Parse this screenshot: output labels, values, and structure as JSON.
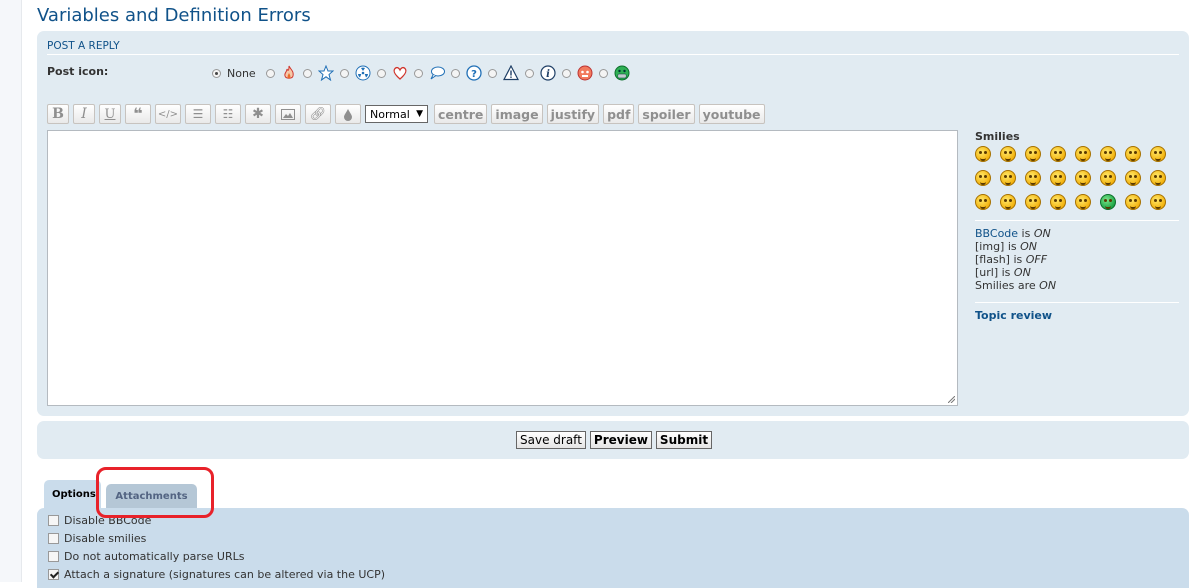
{
  "page_title": "Variables and Definition Errors",
  "panel": {
    "title": "POST A REPLY",
    "post_icon_label": "Post icon:",
    "none_label": "None",
    "icons": [
      "fire-icon",
      "star-icon",
      "radioactive-icon",
      "heart-icon",
      "speech-bubble-icon",
      "question-icon",
      "warning-icon",
      "info-icon",
      "mad-face-icon",
      "grin-face-icon"
    ]
  },
  "toolbar": {
    "buttons": [
      "bold",
      "italic",
      "underline",
      "quote",
      "code",
      "list",
      "list-numbered",
      "list-item",
      "image",
      "url",
      "color"
    ],
    "font_size": "Normal",
    "custom": [
      "centre",
      "image",
      "justify",
      "pdf",
      "spoiler",
      "youtube"
    ]
  },
  "sidebar": {
    "smilies_heading": "Smilies",
    "bbcode": {
      "label": "BBCode",
      "is": " is ",
      "value": "ON"
    },
    "img": {
      "label": "[img] is ",
      "value": "ON"
    },
    "flash": {
      "label": "[flash] is ",
      "value": "OFF"
    },
    "url": {
      "label": "[url] is ",
      "value": "ON"
    },
    "smilies": {
      "label": "Smilies are ",
      "value": "ON"
    },
    "topic_review": "Topic review"
  },
  "buttons": {
    "save_draft": "Save draft",
    "preview": "Preview",
    "submit": "Submit"
  },
  "tabs": {
    "options": "Options",
    "attachments": "Attachments"
  },
  "options": [
    {
      "label": "Disable BBCode",
      "checked": false
    },
    {
      "label": "Disable smilies",
      "checked": false
    },
    {
      "label": "Do not automatically parse URLs",
      "checked": false
    },
    {
      "label": "Attach a signature (signatures can be altered via the UCP)",
      "checked": true
    }
  ],
  "colors": {
    "accent": "#105289",
    "panel": "#e1ebf2",
    "options_panel": "#cadceb",
    "highlight": "#e8222a"
  }
}
